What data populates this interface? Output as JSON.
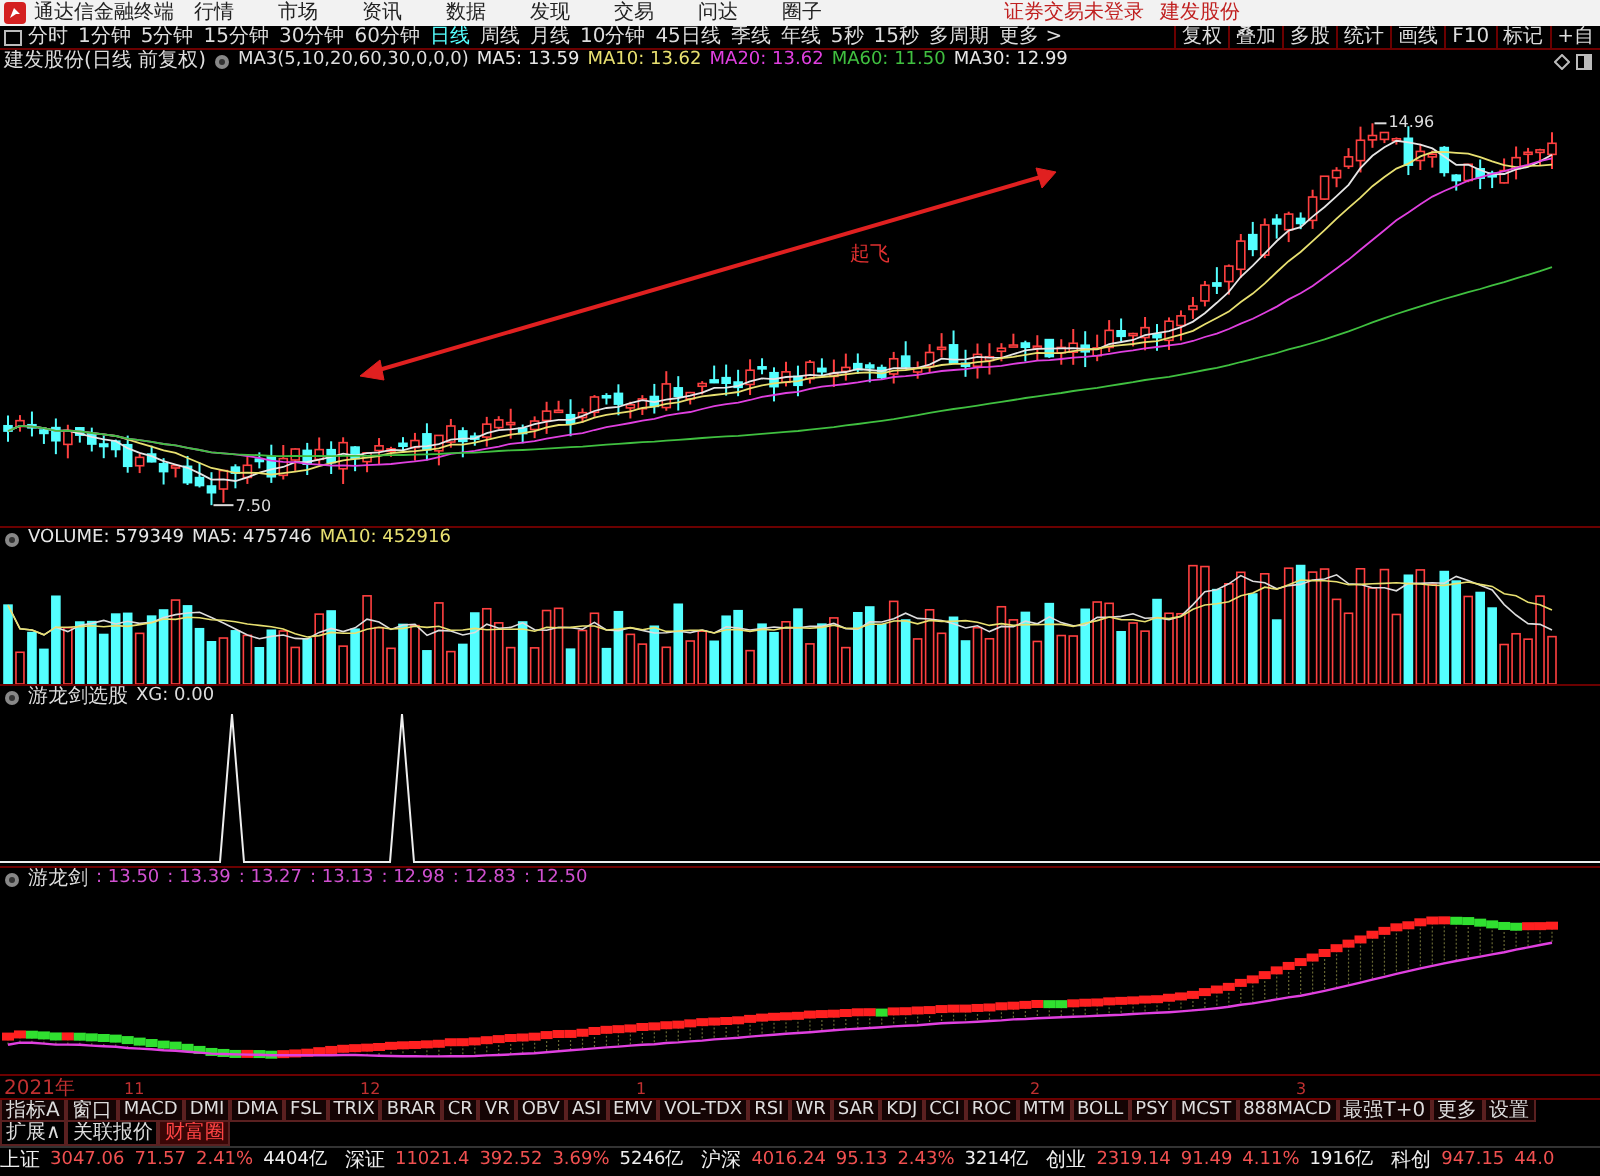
{
  "title_bar": {
    "app_name": "通达信金融终端",
    "menus": [
      "行情",
      "市场",
      "资讯",
      "数据",
      "发现",
      "交易",
      "问达",
      "圈子"
    ],
    "notices": [
      "证券交易未登录",
      "建发股份"
    ]
  },
  "period_tabs": [
    {
      "label": "分时",
      "selected": false
    },
    {
      "label": "1分钟",
      "selected": false
    },
    {
      "label": "5分钟",
      "selected": false
    },
    {
      "label": "15分钟",
      "selected": false
    },
    {
      "label": "30分钟",
      "selected": false
    },
    {
      "label": "60分钟",
      "selected": false
    },
    {
      "label": "日线",
      "selected": true
    },
    {
      "label": "周线",
      "selected": false
    },
    {
      "label": "月线",
      "selected": false
    },
    {
      "label": "10分钟",
      "selected": false
    },
    {
      "label": "45日线",
      "selected": false
    },
    {
      "label": "季线",
      "selected": false
    },
    {
      "label": "年线",
      "selected": false
    },
    {
      "label": "5秒",
      "selected": false
    },
    {
      "label": "15秒",
      "selected": false
    },
    {
      "label": "多周期",
      "selected": false
    },
    {
      "label": "更多 >",
      "selected": false
    }
  ],
  "chart_buttons": [
    "复权",
    "叠加",
    "多股",
    "统计",
    "画线",
    "F10",
    "标记",
    "+自"
  ],
  "main_pane": {
    "legend_title": "建发股份(日线 前复权)",
    "formula": "MA3(5,10,20,60,30,0,0,0)",
    "ma_readings": [
      {
        "label": "MA5: 13.59",
        "color": "#e6e6e6"
      },
      {
        "label": "MA10: 13.62",
        "color": "#e8e070"
      },
      {
        "label": "MA20: 13.62",
        "color": "#e040e0"
      },
      {
        "label": "MA60: 11.50",
        "color": "#40c040"
      },
      {
        "label": "MA30: 12.99",
        "color": "#e6e6e6"
      }
    ],
    "high_label": "14.96",
    "low_label": "7.50",
    "annotation": "起飞"
  },
  "volume_pane": {
    "readings": [
      {
        "label": "VOLUME: 579349",
        "color": "#e6e6e6"
      },
      {
        "label": "MA5: 475746",
        "color": "#e6e6e6"
      },
      {
        "label": "MA10: 452916",
        "color": "#e8e070"
      }
    ]
  },
  "signal_pane": {
    "title": "游龙剑选股",
    "reading": "XG: 0.00"
  },
  "sword_pane": {
    "title": "游龙剑",
    "values": [
      ": 13.50",
      ": 13.39",
      ": 13.27",
      ": 13.13",
      ": 12.98",
      ": 12.83",
      ": 12.50"
    ]
  },
  "date_axis": [
    "2021年",
    "11",
    "12",
    "1",
    "2",
    "3"
  ],
  "indicator_tabs": [
    "指标A",
    "窗口",
    "MACD",
    "DMI",
    "DMA",
    "FSL",
    "TRIX",
    "BRAR",
    "CR",
    "VR",
    "OBV",
    "ASI",
    "EMV",
    "VOL-TDX",
    "RSI",
    "WR",
    "SAR",
    "KDJ",
    "CCI",
    "ROC",
    "MTM",
    "BOLL",
    "PSY",
    "MCST",
    "888MACD",
    "最强T+0",
    "更多",
    "设置"
  ],
  "extension_tabs": [
    {
      "label": "扩展∧",
      "selected": false
    },
    {
      "label": "关联报价",
      "selected": false
    },
    {
      "label": "财富圈",
      "selected": true
    }
  ],
  "status_bar": [
    {
      "name": "上证",
      "index": "3047.06",
      "change": "71.57",
      "percent": "2.41%",
      "amount": "4404亿"
    },
    {
      "name": "深证",
      "index": "11021.4",
      "change": "392.52",
      "percent": "3.69%",
      "amount": "5246亿"
    },
    {
      "name": "沪深",
      "index": "4016.24",
      "change": "95.13",
      "percent": "2.43%",
      "amount": "3214亿"
    },
    {
      "name": "创业",
      "index": "2319.14",
      "change": "91.49",
      "percent": "4.11%",
      "amount": "1916亿"
    },
    {
      "name": "科创",
      "index": "947.15",
      "change": "44.0"
    }
  ]
}
